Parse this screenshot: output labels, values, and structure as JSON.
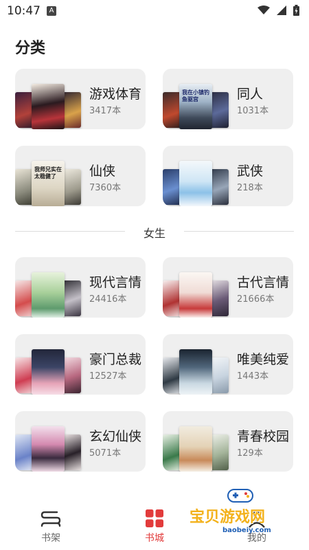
{
  "status_bar": {
    "time": "10:47",
    "notification": "A"
  },
  "section_title": "分类",
  "divider_label": "女生",
  "categories": [
    {
      "name": "游戏体育",
      "count": "3417本",
      "cover_text": ""
    },
    {
      "name": "同人",
      "count": "1031本",
      "cover_text": "我在小镇钓鱼驱宫"
    },
    {
      "name": "仙侠",
      "count": "7360本",
      "cover_text": "我师兄实在太稳健了"
    },
    {
      "name": "武侠",
      "count": "218本",
      "cover_text": ""
    }
  ],
  "female_categories": [
    {
      "name": "现代言情",
      "count": "24416本"
    },
    {
      "name": "古代言情",
      "count": "21666本"
    },
    {
      "name": "豪门总裁",
      "count": "12527本"
    },
    {
      "name": "唯美纯爱",
      "count": "1443本"
    },
    {
      "name": "玄幻仙侠",
      "count": "5071本"
    },
    {
      "name": "青春校园",
      "count": "129本"
    }
  ],
  "nav": {
    "bookshelf": "书架",
    "bookstore": "书城",
    "mine": "我的"
  },
  "watermark": {
    "text": "宝贝游戏网",
    "url": "baobeiy.com"
  },
  "colors": {
    "accent": "#e23b3b",
    "card_bg": "#efefef"
  }
}
